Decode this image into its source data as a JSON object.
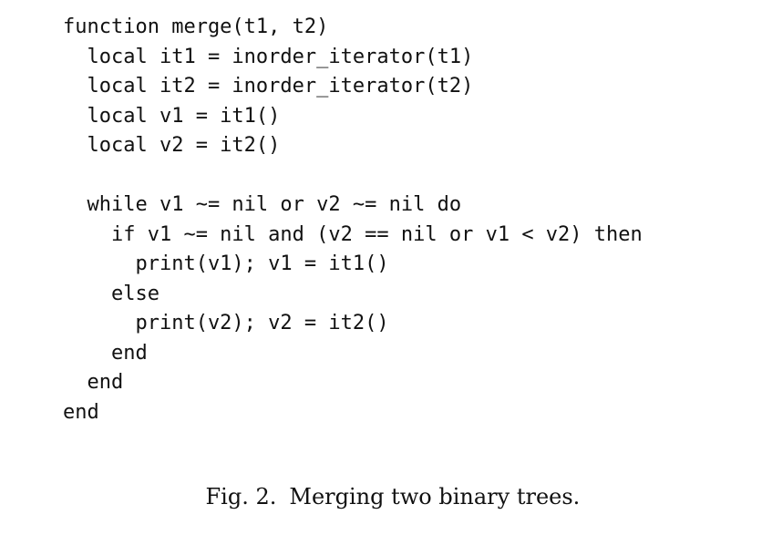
{
  "code": {
    "lines": [
      "function merge(t1, t2)",
      "  local it1 = inorder_iterator(t1)",
      "  local it2 = inorder_iterator(t2)",
      "  local v1 = it1()",
      "  local v2 = it2()",
      "",
      "  while v1 ~= nil or v2 ~= nil do",
      "    if v1 ~= nil and (v2 == nil or v1 < v2) then",
      "      print(v1); v1 = it1()",
      "    else",
      "      print(v2); v2 = it2()",
      "    end",
      "  end",
      "end"
    ]
  },
  "caption": {
    "label": "Fig. 2.",
    "text": "Merging two binary trees."
  }
}
